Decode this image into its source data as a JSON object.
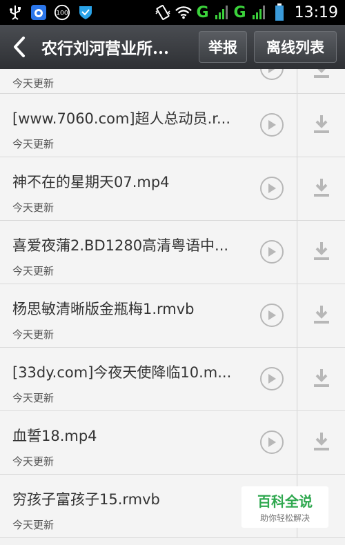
{
  "status_bar": {
    "icons": [
      "usb-icon",
      "baidu-icon",
      "battery-saver-icon",
      "shield-icon",
      "vibrate-icon",
      "wifi-icon",
      "signal-icon",
      "signal2-icon",
      "battery-icon"
    ],
    "network1": "G",
    "network2": "G",
    "time": "13:19"
  },
  "header": {
    "title": "农行刘河营业所...",
    "report_label": "举报",
    "offline_label": "离线列表"
  },
  "list": {
    "items": [
      {
        "title": "",
        "subtitle": "今天更新"
      },
      {
        "title": "[www.7060.com]超人总动员.r...",
        "subtitle": "今天更新"
      },
      {
        "title": "神不在的星期天07.mp4",
        "subtitle": "今天更新"
      },
      {
        "title": "喜爱夜蒲2.BD1280高清粤语中...",
        "subtitle": "今天更新"
      },
      {
        "title": "杨思敏清晰版金瓶梅1.rmvb",
        "subtitle": "今天更新"
      },
      {
        "title": "[33dy.com]今夜天使降临10.m...",
        "subtitle": "今天更新"
      },
      {
        "title": "血誓18.mp4",
        "subtitle": "今天更新"
      },
      {
        "title": "穷孩子富孩子15.rmvb",
        "subtitle": "今天更新"
      }
    ]
  },
  "watermark": {
    "main": "百科全说",
    "sub": "助你轻松解决"
  },
  "colors": {
    "status_bg": "#000000",
    "network_green": "#3bd23b",
    "title_bar": "#3a3d41",
    "list_bg": "#f4f4f4",
    "watermark_green": "#2fa84f"
  }
}
